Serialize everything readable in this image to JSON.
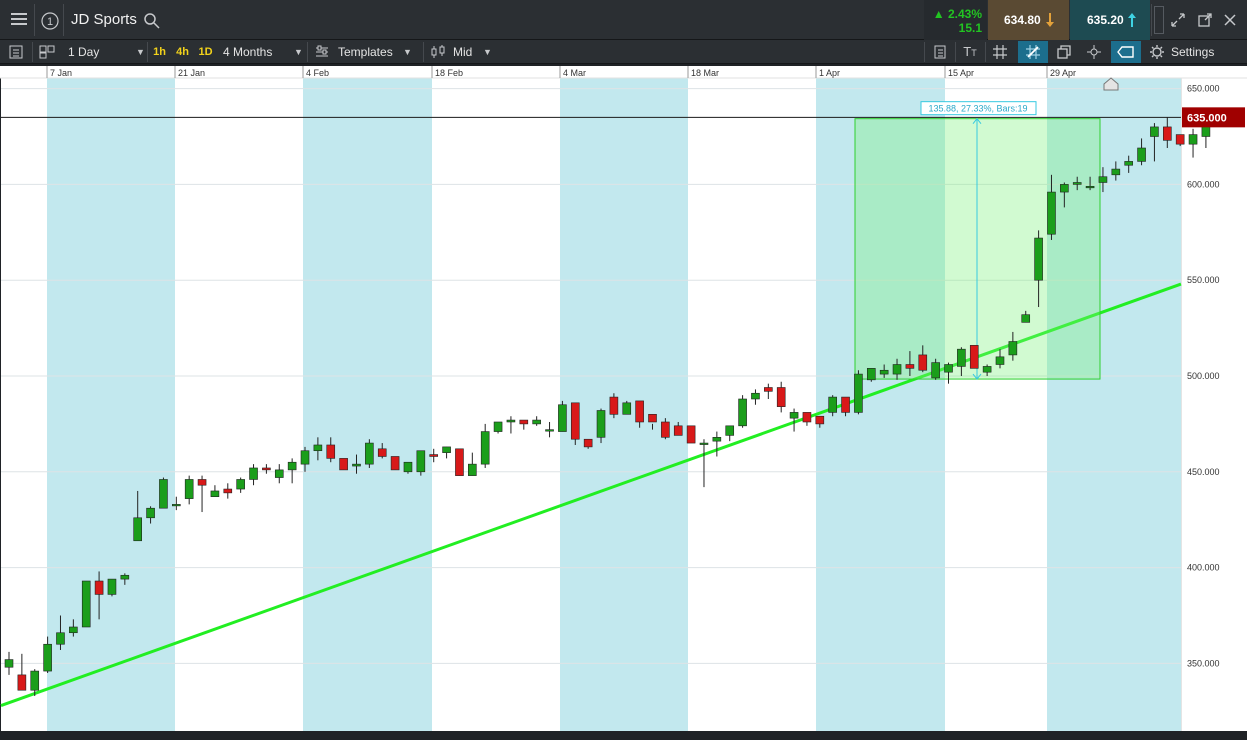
{
  "header": {
    "instrument": "JD Sports",
    "change_pct": "2.43%",
    "change_abs": "15.1",
    "sell_price": "634.80",
    "buy_price": "635.20",
    "colors": {
      "up": "#22c422",
      "sell_bg": "#5a4a33",
      "buy_bg": "#1e4b52"
    }
  },
  "toolbar": {
    "interval": "1 Day",
    "timeframes": [
      "1h",
      "4h",
      "1D"
    ],
    "range": "4 Months",
    "templates": "Templates",
    "price_type": "Mid",
    "settings": "Settings",
    "icons": [
      "menu-icon",
      "info-icon",
      "search-icon",
      "layout-icon",
      "chart-type-icon",
      "candles-icon",
      "text-size-icon",
      "grid-icon",
      "crosshair-icon",
      "copy-icon",
      "target-icon",
      "tag-icon",
      "gear-icon",
      "expand-icon",
      "popout-icon",
      "close-icon"
    ]
  },
  "chart_data": {
    "type": "candlestick",
    "x_labels": [
      "7 Jan",
      "21 Jan",
      "4 Feb",
      "18 Feb",
      "4 Mar",
      "18 Mar",
      "1 Apr",
      "15 Apr",
      "29 Apr"
    ],
    "y_ticks": [
      "650.000",
      "600.000",
      "550.000",
      "500.000",
      "450.000",
      "400.000",
      "350.000"
    ],
    "ylim": [
      320,
      660
    ],
    "current_price_label": "635.000",
    "current_price": 635,
    "measure_label": "135.88, 27.33%, Bars:19",
    "measure_range": [
      498.4,
      634.3
    ],
    "trendline": {
      "start": 328,
      "end": 548
    },
    "colors": {
      "up": "#1b9e1b",
      "down": "#d81919",
      "band": "#c2e8ee",
      "trend": "#22ee22",
      "measure_fill": "#7cf27c",
      "measure_line": "#37c9e0",
      "current": "#a00000"
    },
    "candles": [
      [
        348,
        356,
        344,
        352
      ],
      [
        344,
        355,
        336,
        336
      ],
      [
        336,
        347,
        333,
        346
      ],
      [
        346,
        364,
        345,
        360
      ],
      [
        360,
        375,
        357,
        366
      ],
      [
        366,
        373,
        364,
        369
      ],
      [
        369,
        393,
        369,
        393
      ],
      [
        393,
        398,
        373,
        386
      ],
      [
        386,
        394,
        385,
        394
      ],
      [
        394,
        397,
        391,
        396
      ],
      [
        414,
        440,
        414,
        426
      ],
      [
        426,
        432,
        423,
        431
      ],
      [
        431,
        447,
        431,
        446
      ],
      [
        433,
        437,
        430,
        433
      ],
      [
        436,
        448,
        433,
        446
      ],
      [
        446,
        448,
        429,
        443
      ],
      [
        437,
        443,
        437,
        440
      ],
      [
        441,
        444,
        436,
        439
      ],
      [
        441,
        447,
        439,
        446
      ],
      [
        446,
        454,
        443,
        452
      ],
      [
        452,
        454,
        449,
        451
      ],
      [
        447,
        454,
        444,
        451
      ],
      [
        451,
        457,
        444,
        455
      ],
      [
        454,
        463,
        450,
        461
      ],
      [
        461,
        468,
        456,
        464
      ],
      [
        464,
        468,
        455,
        457
      ],
      [
        457,
        455,
        451,
        451
      ],
      [
        453,
        459,
        449,
        454
      ],
      [
        454,
        467,
        452,
        465
      ],
      [
        462,
        465,
        457,
        458
      ],
      [
        458,
        454,
        451,
        451
      ],
      [
        450,
        455,
        449,
        455
      ],
      [
        450,
        460,
        448,
        461
      ],
      [
        459,
        462,
        455,
        458
      ],
      [
        460,
        463,
        457,
        463
      ],
      [
        462,
        458,
        448,
        448
      ],
      [
        448,
        460,
        448,
        454
      ],
      [
        454,
        475,
        452,
        471
      ],
      [
        471,
        475,
        470,
        476
      ],
      [
        476,
        479,
        470,
        477
      ],
      [
        477,
        475,
        472,
        475
      ],
      [
        475,
        479,
        474,
        477
      ],
      [
        472,
        476,
        468,
        472
      ],
      [
        471,
        487,
        471,
        485
      ],
      [
        486,
        484,
        464,
        467
      ],
      [
        467,
        463,
        462,
        463
      ],
      [
        468,
        483,
        465,
        482
      ],
      [
        489,
        491,
        478,
        480
      ],
      [
        480,
        487,
        480,
        486
      ],
      [
        487,
        485,
        473,
        476
      ],
      [
        480,
        475,
        472,
        476
      ],
      [
        476,
        478,
        467,
        468
      ],
      [
        474,
        476,
        470,
        469
      ],
      [
        474,
        471,
        466,
        465
      ],
      [
        465,
        467,
        442,
        465
      ],
      [
        466,
        471,
        458,
        468
      ],
      [
        469,
        474,
        466,
        474
      ],
      [
        474,
        490,
        473,
        488
      ],
      [
        488,
        493,
        485,
        491
      ],
      [
        494,
        496,
        488,
        492
      ],
      [
        494,
        497,
        481,
        484
      ],
      [
        478,
        483,
        471,
        481
      ],
      [
        481,
        480,
        474,
        476
      ],
      [
        479,
        475,
        473,
        475
      ],
      [
        481,
        490,
        479,
        489
      ],
      [
        489,
        488,
        479,
        481
      ],
      [
        481,
        503,
        480,
        501
      ],
      [
        498,
        504,
        497,
        504
      ],
      [
        501,
        506,
        499,
        503
      ],
      [
        501,
        509,
        498,
        506
      ],
      [
        506,
        513,
        500,
        504
      ],
      [
        511,
        516,
        502,
        503
      ],
      [
        499,
        509,
        498,
        507
      ],
      [
        502,
        507,
        496,
        506
      ],
      [
        505,
        515,
        500,
        514
      ],
      [
        516,
        512,
        504,
        504
      ],
      [
        502,
        506,
        500,
        505
      ],
      [
        506,
        514,
        504,
        510
      ],
      [
        511,
        523,
        508,
        518
      ],
      [
        528,
        534,
        528,
        532
      ],
      [
        550,
        576,
        536,
        572
      ],
      [
        574,
        605,
        571,
        596
      ],
      [
        596,
        601,
        588,
        600
      ],
      [
        600,
        604,
        597,
        601
      ],
      [
        599,
        604,
        597,
        599
      ],
      [
        601,
        609,
        596,
        604
      ],
      [
        605,
        612,
        602,
        608
      ],
      [
        610,
        615,
        606,
        612
      ],
      [
        612,
        624,
        610,
        619
      ],
      [
        625,
        632,
        612,
        630
      ],
      [
        630,
        635,
        619,
        623
      ],
      [
        626,
        626,
        620,
        621
      ],
      [
        621,
        629,
        614,
        626
      ],
      [
        625,
        634,
        619,
        635
      ]
    ]
  }
}
